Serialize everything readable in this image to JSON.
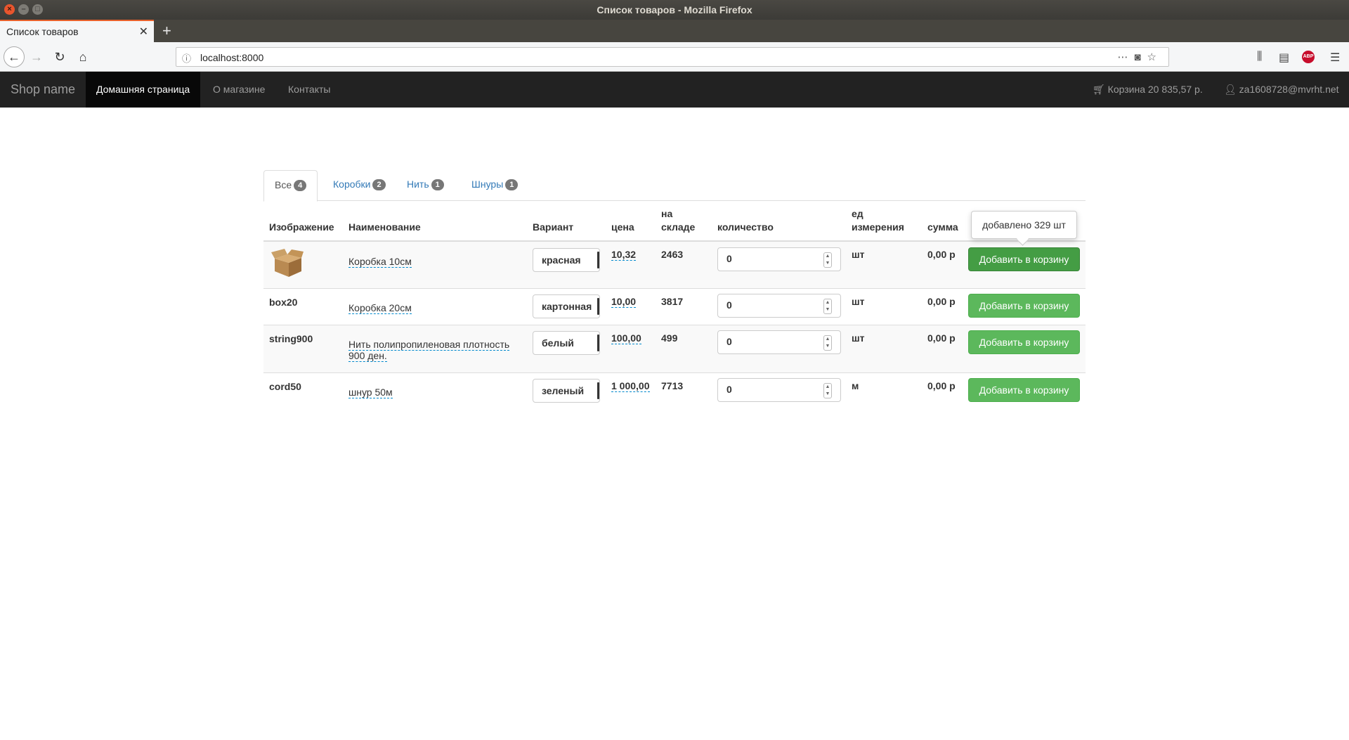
{
  "window": {
    "title": "Список товаров - Mozilla Firefox"
  },
  "browser": {
    "tab_title": "Список товаров",
    "url": "localhost:8000",
    "abp_label": "ABP"
  },
  "site": {
    "brand": "Shop name",
    "nav": [
      "Домашняя страница",
      "О магазине",
      "Контакты"
    ],
    "cart": "Корзина 20 835,57 р.",
    "user": "za1608728@mvrht.net"
  },
  "tabs": [
    {
      "label": "Все",
      "count": "4"
    },
    {
      "label": "Коробки",
      "count": "2"
    },
    {
      "label": "Нить",
      "count": "1"
    },
    {
      "label": "Шнуры",
      "count": "1"
    }
  ],
  "table": {
    "headers": {
      "image": "Изображение",
      "name": "Наименование",
      "variant": "Вариант",
      "price": "цена",
      "stock_1": "на",
      "stock_2": "складе",
      "qty": "количество",
      "unit_1": "ед",
      "unit_2": "измерения",
      "sum": "сумма"
    },
    "rows": [
      {
        "image": "box",
        "name": "Коробка 10см",
        "variant": "красная",
        "price": "10,32",
        "stock": "2463",
        "qty": "0",
        "unit": "шт",
        "sum": "0,00 р",
        "button": "Добавить в корзину"
      },
      {
        "image": "box20",
        "name": "Коробка 20см",
        "variant": "картонная",
        "price": "10,00",
        "stock": "3817",
        "qty": "0",
        "unit": "шт",
        "sum": "0,00 р",
        "button": "Добавить в корзину"
      },
      {
        "image": "string900",
        "name_1": "Нить полипропиленовая плотность",
        "name_2": "900 ден.",
        "variant": "белый",
        "price": "100,00",
        "stock": "499",
        "qty": "0",
        "unit": "шт",
        "sum": "0,00 р",
        "button": "Добавить в корзину"
      },
      {
        "image": "cord50",
        "name": "шнур 50м",
        "variant": "зеленый",
        "price": "1 000,00",
        "stock": "7713",
        "qty": "0",
        "unit": "м",
        "sum": "0,00 р",
        "button": "Добавить в корзину"
      }
    ]
  },
  "tooltip": "добавлено 329 шт"
}
